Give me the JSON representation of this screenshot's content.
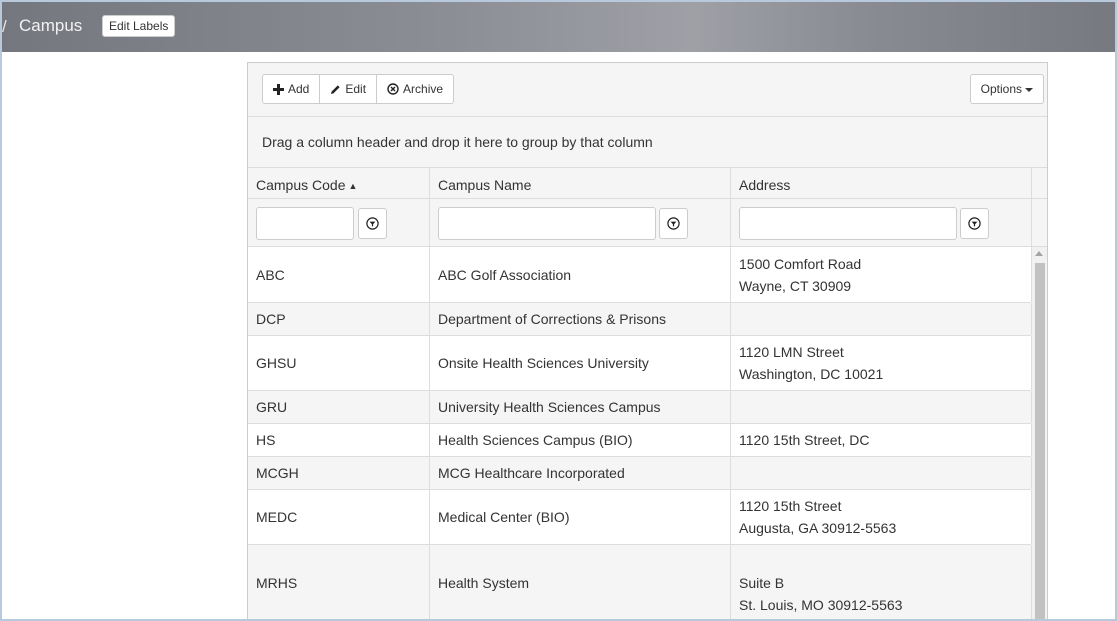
{
  "header": {
    "separator": "/",
    "title": "Campus",
    "edit_labels": "Edit Labels"
  },
  "toolbar": {
    "add_label": "Add",
    "edit_label": "Edit",
    "archive_label": "Archive",
    "options_label": "Options"
  },
  "grid": {
    "group_hint": "Drag a column header and drop it here to group by that column",
    "columns": [
      {
        "label": "Campus Code",
        "sort": "ascending"
      },
      {
        "label": "Campus Name"
      },
      {
        "label": "Address"
      }
    ],
    "filters": {
      "code_value": "",
      "name_value": "",
      "address_value": ""
    },
    "rows": [
      {
        "code": "ABC",
        "name": "ABC Golf Association",
        "address1": "1500 Comfort Road",
        "address2": "Wayne, CT 30909"
      },
      {
        "code": "DCP",
        "name": "Department of Corrections & Prisons",
        "address1": "",
        "address2": ""
      },
      {
        "code": "GHSU",
        "name": "Onsite Health Sciences University",
        "address1": "1120 LMN Street",
        "address2": "Washington, DC 10021"
      },
      {
        "code": "GRU",
        "name": "University Health Sciences Campus",
        "address1": "",
        "address2": ""
      },
      {
        "code": "HS",
        "name": "Health Sciences Campus (BIO)",
        "address1": "1120 15th Street, DC",
        "address2": ""
      },
      {
        "code": "MCGH",
        "name": "MCG Healthcare Incorporated",
        "address1": "",
        "address2": ""
      },
      {
        "code": "MEDC",
        "name": "Medical Center (BIO)",
        "address1": "1120 15th Street",
        "address2": "Augusta, GA 30912-5563"
      },
      {
        "code": "MRHS",
        "name": "Health System",
        "address1": "Suite B",
        "address2": "St. Louis, MO 30912-5563"
      }
    ]
  },
  "icons": {
    "add": "plus-icon",
    "edit": "pencil-icon",
    "archive": "circle-x-icon",
    "filter": "filter-icon",
    "sort": "sort-up-icon"
  }
}
